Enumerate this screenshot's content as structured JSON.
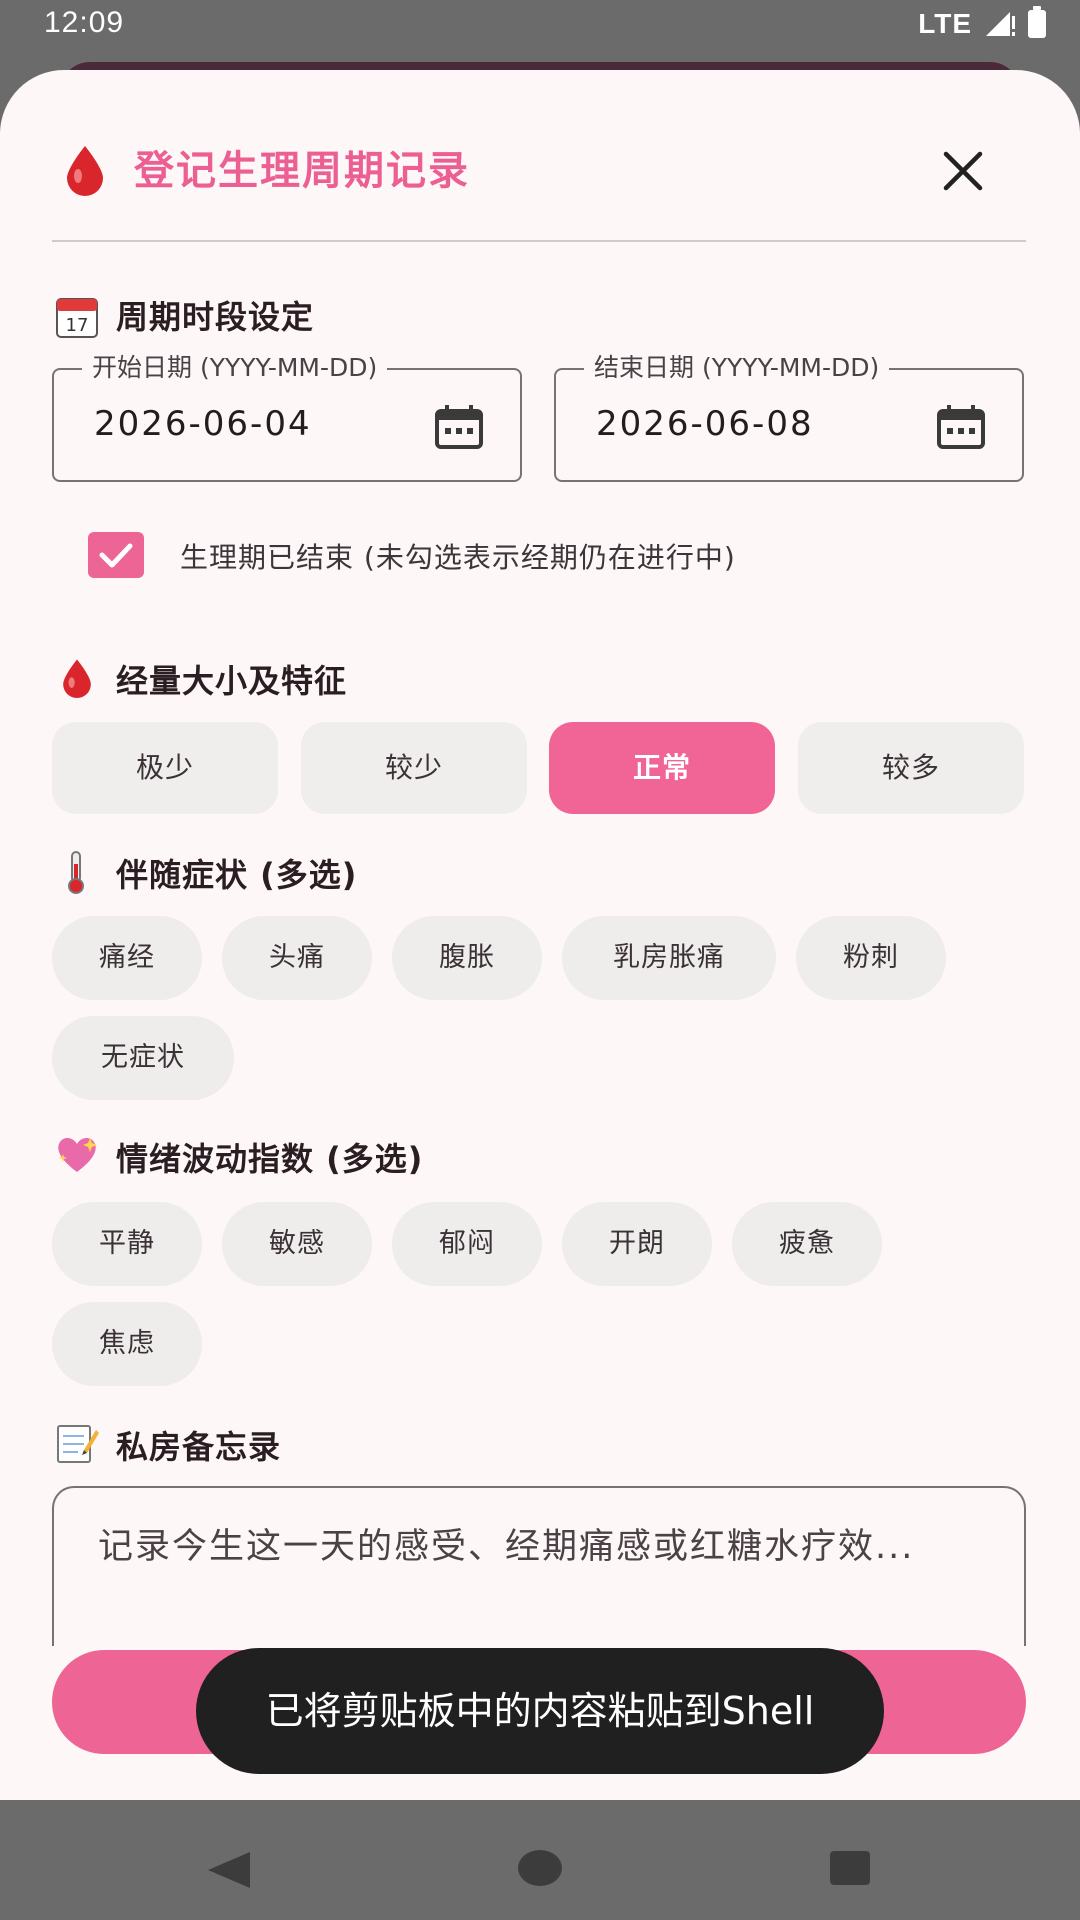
{
  "status_bar": {
    "time": "12:09",
    "network": "LTE"
  },
  "dialog": {
    "title": "登记生理周期记录",
    "sections": {
      "period": "周期时段设定",
      "flow": "经量大小及特征",
      "symptoms": "伴随症状 (多选)",
      "mood": "情绪波动指数 (多选)",
      "memo": "私房备忘录"
    },
    "start_date": {
      "label": "开始日期 (YYYY-MM-DD)",
      "value": "2026-06-04"
    },
    "end_date": {
      "label": "结束日期 (YYYY-MM-DD)",
      "value": "2026-06-08"
    },
    "period_ended": {
      "checked": true,
      "label": "生理期已结束 (未勾选表示经期仍在进行中)"
    },
    "flow_options": [
      "极少",
      "较少",
      "正常",
      "较多"
    ],
    "flow_selected": "正常",
    "symptom_options": [
      "痛经",
      "头痛",
      "腹胀",
      "乳房胀痛",
      "粉刺",
      "无症状"
    ],
    "mood_options": [
      "平静",
      "敏感",
      "郁闷",
      "开朗",
      "疲惫",
      "焦虑"
    ],
    "memo_placeholder": "记录今生这一天的感受、经期痛感或红糖水疗效..."
  },
  "toast": "已将剪贴板中的内容粘贴到Shell",
  "colors": {
    "accent": "#ec5f92",
    "chip_bg": "#efecec",
    "sheet_bg": "#fdf7f7"
  }
}
